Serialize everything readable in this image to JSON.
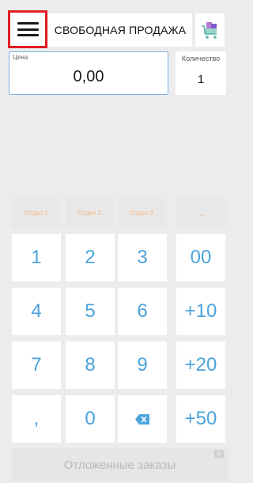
{
  "header": {
    "mode_label": "СВОБОДНАЯ ПРОДАЖА",
    "menu_icon": "hamburger-menu-icon",
    "cart_icon": "shopping-cart-icon"
  },
  "price": {
    "label": "Цена",
    "value": "0,00"
  },
  "quantity": {
    "label": "Количество",
    "value": "1"
  },
  "departments": [
    "Отдел 1",
    "Отдел 2",
    "Отдел 3"
  ],
  "more_departments": "...",
  "keypad": {
    "row1": [
      "1",
      "2",
      "3",
      "00"
    ],
    "row2": [
      "4",
      "5",
      "6",
      "+10"
    ],
    "row3": [
      "7",
      "8",
      "9",
      "+20"
    ],
    "row4": [
      ",",
      "0",
      "",
      "+50"
    ],
    "backspace_icon": "backspace-icon"
  },
  "deferred": {
    "label": "Отложенные заказы",
    "count": "0"
  },
  "colors": {
    "accent": "#4ba3dc",
    "highlight_border": "#e31d25",
    "department_text": "#f3b783",
    "background": "#ececec"
  }
}
